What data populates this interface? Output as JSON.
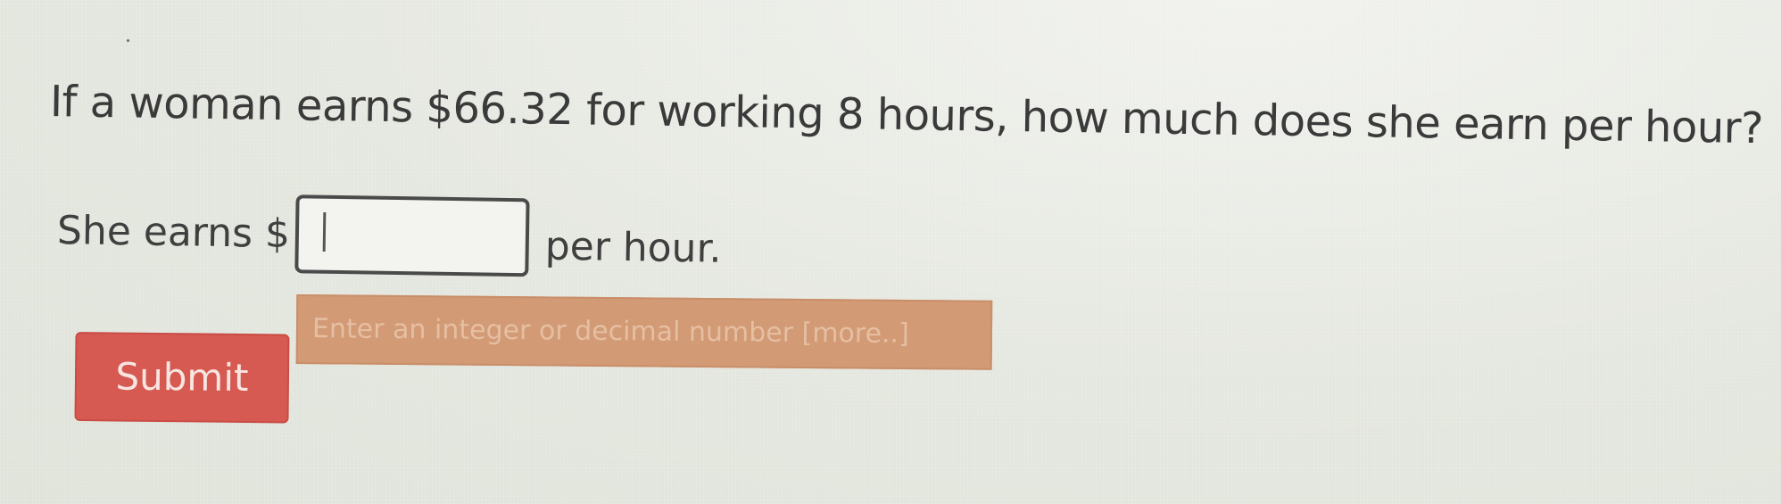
{
  "question": {
    "text": "If a woman earns $66.32 for working 8 hours, how much does she earn per hour?"
  },
  "answer": {
    "prefix": "She earns $",
    "input_value": "",
    "suffix": "per hour."
  },
  "hint": {
    "text": "Enter an integer or decimal number [more..]"
  },
  "submit": {
    "label": "Submit"
  },
  "colors": {
    "submit_background": "#d65a52",
    "hint_background": "#d29a75",
    "page_background": "#e6e9e2"
  }
}
